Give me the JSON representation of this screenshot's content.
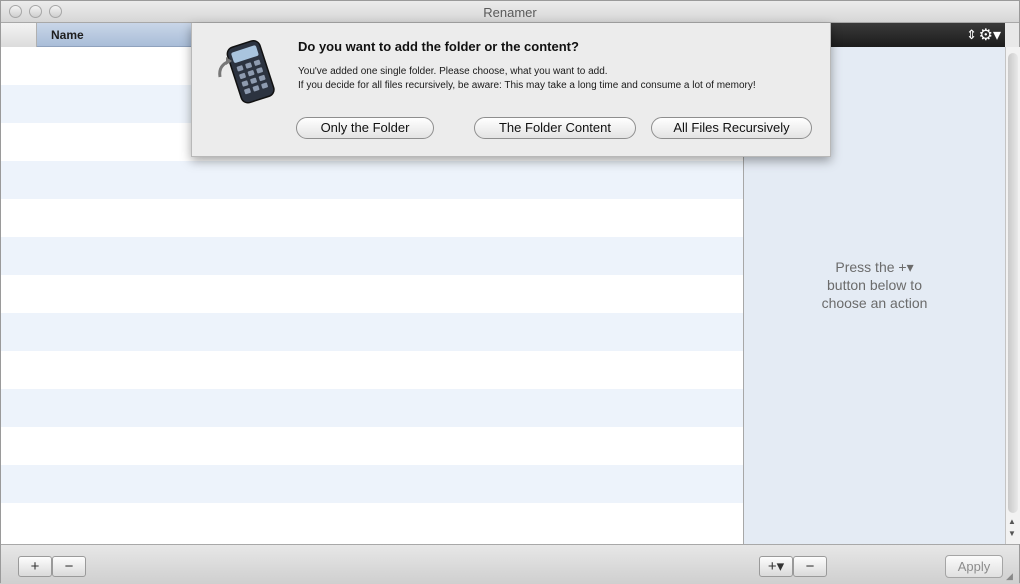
{
  "window": {
    "title": "Renamer"
  },
  "files": {
    "column_name": "Name",
    "row_count": 13
  },
  "actions": {
    "hint_line1": "Press the +▾",
    "hint_line2": "button below to",
    "hint_line3": "choose an action"
  },
  "bottom": {
    "add_label": "+",
    "remove_label": "−",
    "add_action_label": "+▾",
    "remove_action_label": "−",
    "apply_label": "Apply"
  },
  "dialog": {
    "headline": "Do you want to add the folder or the content?",
    "line1": "You've added one single folder. Please choose, what you want to add.",
    "line2": "If you decide for all files recursively, be aware: This may take a long time and consume a lot of memory!",
    "button_only_folder": "Only the Folder",
    "button_folder_content": "The Folder Content",
    "button_all_files": "All Files Recursively"
  },
  "colors": {
    "row_alt": "#edf3fb",
    "header_blue": "#b8c9e0",
    "action_header": "#262626"
  },
  "icons": [
    "calculator-app-icon",
    "gear-icon",
    "sort-stepper-icon",
    "resize-grip-icon"
  ]
}
